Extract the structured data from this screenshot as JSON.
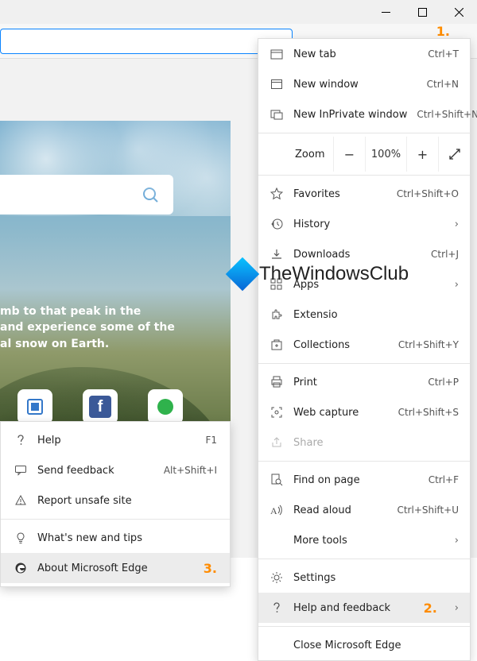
{
  "annotations": {
    "one": "1.",
    "two": "2.",
    "three": "3."
  },
  "zoom": {
    "label": "Zoom",
    "value": "100%"
  },
  "menu": {
    "new_tab": {
      "label": "New tab",
      "shortcut": "Ctrl+T"
    },
    "new_window": {
      "label": "New window",
      "shortcut": "Ctrl+N"
    },
    "inprivate": {
      "label": "New InPrivate window",
      "shortcut": "Ctrl+Shift+N"
    },
    "favorites": {
      "label": "Favorites",
      "shortcut": "Ctrl+Shift+O"
    },
    "history": {
      "label": "History"
    },
    "downloads": {
      "label": "Downloads",
      "shortcut": "Ctrl+J"
    },
    "apps": {
      "label": "Apps"
    },
    "extensions": {
      "label": "Extensio"
    },
    "collections": {
      "label": "Collections",
      "shortcut": "Ctrl+Shift+Y"
    },
    "print": {
      "label": "Print",
      "shortcut": "Ctrl+P"
    },
    "webcapture": {
      "label": "Web capture",
      "shortcut": "Ctrl+Shift+S"
    },
    "share": {
      "label": "Share"
    },
    "find": {
      "label": "Find on page",
      "shortcut": "Ctrl+F"
    },
    "readaloud": {
      "label": "Read aloud",
      "shortcut": "Ctrl+Shift+U"
    },
    "moretools": {
      "label": "More tools"
    },
    "settings": {
      "label": "Settings"
    },
    "help": {
      "label": "Help and feedback"
    },
    "close": {
      "label": "Close Microsoft Edge"
    }
  },
  "submenu": {
    "help": {
      "label": "Help",
      "shortcut": "F1"
    },
    "feedback": {
      "label": "Send feedback",
      "shortcut": "Alt+Shift+I"
    },
    "report": {
      "label": "Report unsafe site"
    },
    "whatsnew": {
      "label": "What's new and tips"
    },
    "about": {
      "label": "About Microsoft Edge"
    }
  },
  "blurb": "mb to that peak in the\nand experience some of the\nal snow on Earth.",
  "watermark": "TheWindowsClub"
}
